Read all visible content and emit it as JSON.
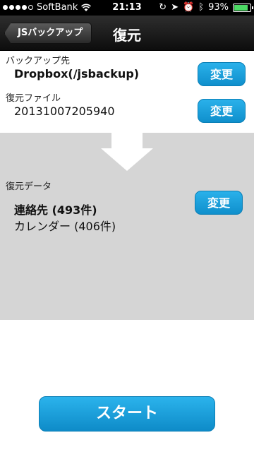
{
  "status": {
    "carrier": "SoftBank",
    "time": "21:13",
    "battery": "93%"
  },
  "nav": {
    "back_label": "JSバックアップ",
    "title": "復元"
  },
  "backup_dest": {
    "label": "バックアップ先",
    "value": "Dropbox(/jsbackup)",
    "button": "変更"
  },
  "restore_file": {
    "label": "復元ファイル",
    "value": "20131007205940",
    "button": "変更"
  },
  "restore_data": {
    "label": "復元データ",
    "items": [
      "連絡先 (493件)",
      "カレンダー (406件)"
    ],
    "button": "変更"
  },
  "start_button": "スタート",
  "colors": {
    "accent": "#1aa3df",
    "panel": "#d5d5d5"
  }
}
